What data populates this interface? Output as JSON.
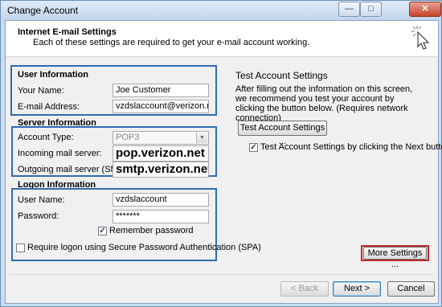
{
  "window": {
    "title": "Change Account"
  },
  "title_controls": {
    "minimize": "—",
    "maximize": "□",
    "close": "✕"
  },
  "header": {
    "title": "Internet E-mail Settings",
    "subtitle": "Each of these settings are required to get your e-mail account working."
  },
  "user_info": {
    "heading": "User Information",
    "name_label": "Your Name:",
    "name_value": "Joe Customer",
    "email_label": "E-mail Address:",
    "email_value": "vzdslaccount@verizon.net"
  },
  "server_info": {
    "heading": "Server Information",
    "account_type_label": "Account Type:",
    "account_type_value": "POP3",
    "incoming_label": "Incoming mail server:",
    "incoming_value": "pop.verizon.net",
    "outgoing_label": "Outgoing mail server (SMTP):",
    "outgoing_value": "smtp.verizon.net"
  },
  "logon_info": {
    "heading": "Logon Information",
    "username_label": "User Name:",
    "username_value": "vzdslaccount",
    "password_label": "Password:",
    "password_value": "*******",
    "remember_label": "Remember password",
    "remember_checked": true,
    "spa_label": "Require logon using Secure Password Authentication (SPA)",
    "spa_checked": false
  },
  "test": {
    "heading": "Test Account Settings",
    "description": "After filling out the information on this screen, we recommend you test your account by clicking the button below. (Requires network connection)",
    "test_button": "Test Account Settings ...",
    "next_test_label": "Test Account Settings by clicking the Next button",
    "next_test_checked": true
  },
  "buttons": {
    "more_settings": "More Settings ...",
    "back": "< Back",
    "next": "Next >",
    "cancel": "Cancel"
  },
  "colors": {
    "highlight_blue": "#2f6cb0",
    "highlight_red": "#c0282d"
  },
  "icons": {
    "header": "cursor-click-icon",
    "dropdown": "chevron-down-icon",
    "checkmark": "checkmark-icon"
  }
}
